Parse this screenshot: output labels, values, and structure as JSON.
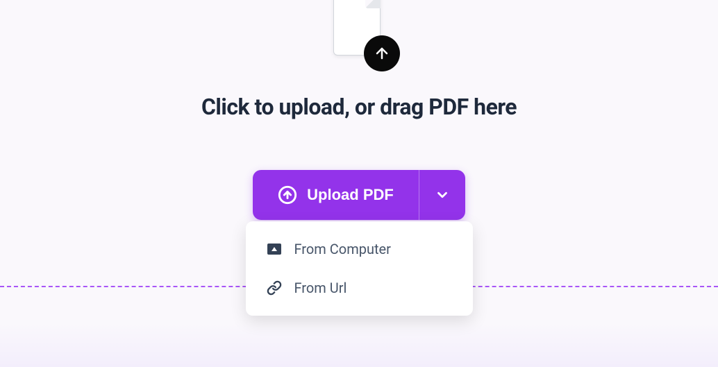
{
  "heading": "Click to upload, or drag PDF here",
  "button": {
    "label": "Upload PDF"
  },
  "dropdown": {
    "items": [
      {
        "label": "From Computer"
      },
      {
        "label": "From Url"
      }
    ]
  },
  "colors": {
    "accent": "#9333ea",
    "text": "#1e293b",
    "muted": "#475569"
  }
}
